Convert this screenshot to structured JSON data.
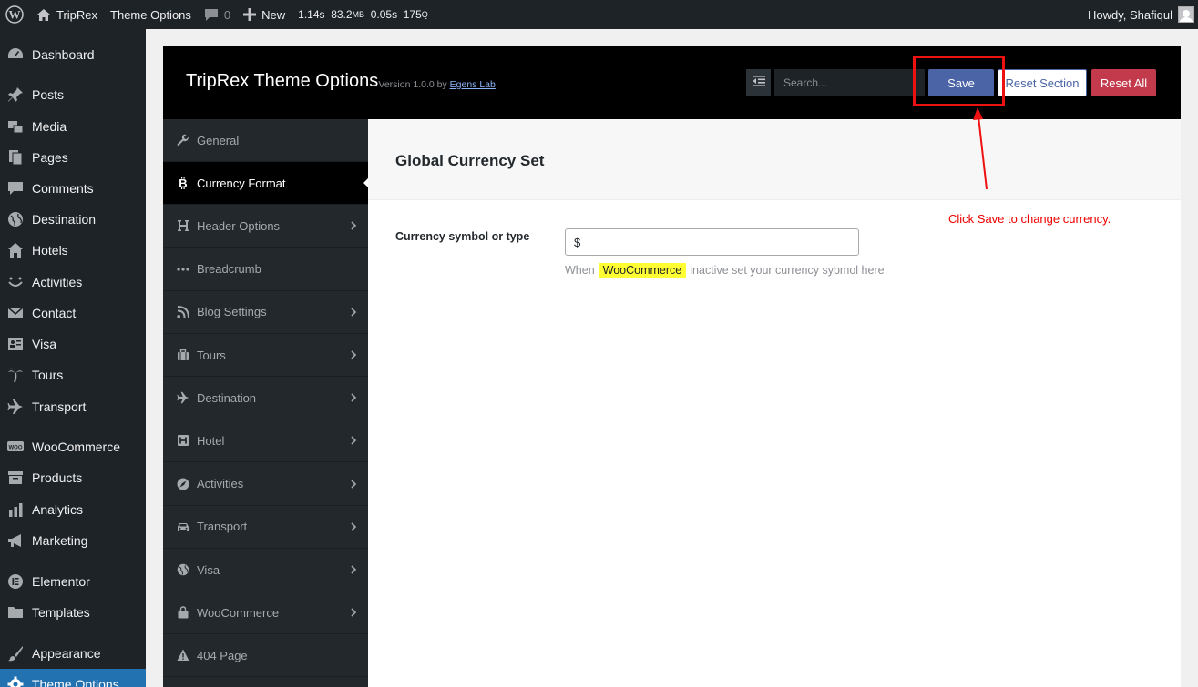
{
  "adminbar": {
    "site_name": "TripRex",
    "theme_options": "Theme Options",
    "comments_count": "0",
    "new_label": "New",
    "stats": [
      "1.14s",
      "83.2",
      "MB",
      "0.05s",
      "175",
      "Q"
    ],
    "howdy": "Howdy, Shafiqul"
  },
  "sidebar": {
    "items": [
      {
        "label": "Dashboard",
        "icon": "dashboard-icon"
      },
      {
        "label": "Posts",
        "icon": "pin-icon"
      },
      {
        "label": "Media",
        "icon": "media-icon"
      },
      {
        "label": "Pages",
        "icon": "pages-icon"
      },
      {
        "label": "Comments",
        "icon": "comment-icon"
      },
      {
        "label": "Destination",
        "icon": "globe-icon"
      },
      {
        "label": "Hotels",
        "icon": "home-icon"
      },
      {
        "label": "Activities",
        "icon": "smile-icon"
      },
      {
        "label": "Contact",
        "icon": "mail-icon"
      },
      {
        "label": "Visa",
        "icon": "id-card-icon"
      },
      {
        "label": "Tours",
        "icon": "palm-tree-icon"
      },
      {
        "label": "Transport",
        "icon": "plane-icon"
      },
      {
        "label": "WooCommerce",
        "icon": "woo-icon"
      },
      {
        "label": "Products",
        "icon": "archive-icon"
      },
      {
        "label": "Analytics",
        "icon": "bar-chart-icon"
      },
      {
        "label": "Marketing",
        "icon": "megaphone-icon"
      },
      {
        "label": "Elementor",
        "icon": "elementor-icon"
      },
      {
        "label": "Templates",
        "icon": "folder-icon"
      },
      {
        "label": "Appearance",
        "icon": "brush-icon"
      },
      {
        "label": "Theme Options",
        "icon": "gear-icon"
      }
    ]
  },
  "panel": {
    "title": "TripRex Theme Options",
    "version": "- Version 1.0.0  by ",
    "author": "Egens Lab",
    "search_placeholder": "Search...",
    "save": "Save",
    "reset_section": "Reset Section",
    "reset_all": "Reset All"
  },
  "nav": {
    "items": [
      {
        "label": "General",
        "icon": "wrench-icon",
        "chevron": false
      },
      {
        "label": "Currency Format",
        "icon": "bitcoin-icon",
        "chevron": false,
        "active": true
      },
      {
        "label": "Header Options",
        "icon": "heading-icon",
        "chevron": true
      },
      {
        "label": "Breadcrumb",
        "icon": "ellipsis-icon",
        "chevron": false
      },
      {
        "label": "Blog Settings",
        "icon": "rss-icon",
        "chevron": true
      },
      {
        "label": "Tours",
        "icon": "suitcase-icon",
        "chevron": true
      },
      {
        "label": "Destination",
        "icon": "plane-icon",
        "chevron": true
      },
      {
        "label": "Hotel",
        "icon": "hotel-icon",
        "chevron": true
      },
      {
        "label": "Activities",
        "icon": "compass-icon",
        "chevron": true
      },
      {
        "label": "Transport",
        "icon": "car-icon",
        "chevron": true
      },
      {
        "label": "Visa",
        "icon": "globe-icon",
        "chevron": true
      },
      {
        "label": "WooCommerce",
        "icon": "bag-icon",
        "chevron": true
      },
      {
        "label": "404 Page",
        "icon": "warning-icon",
        "chevron": false
      }
    ]
  },
  "content": {
    "title": "Global Currency Set",
    "field_label": "Currency symbol or type",
    "field_value": "$",
    "desc_before": "When",
    "desc_highlight": "WooCommerce",
    "desc_after": "inactive set your currency sybmol here"
  },
  "annotation": {
    "note": "Click Save to change currency.",
    "color": "#ee1111"
  }
}
